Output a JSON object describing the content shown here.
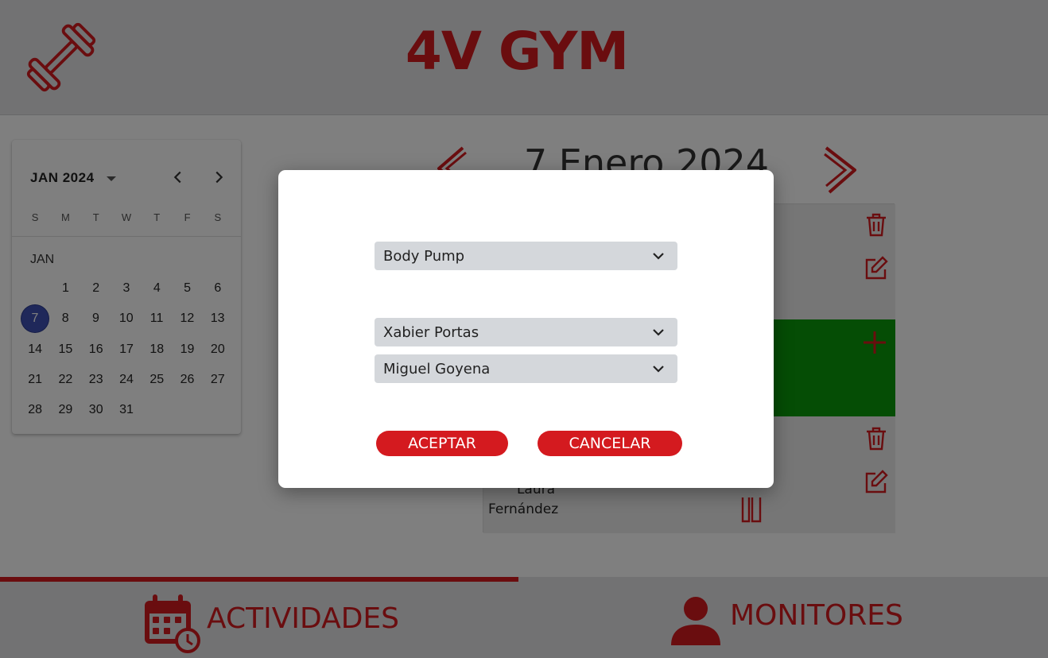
{
  "header": {
    "title": "4V GYM",
    "logo_icon": "dumbbell-icon"
  },
  "calendar": {
    "period_label": "JAN 2024",
    "weekdays": [
      "S",
      "M",
      "T",
      "W",
      "T",
      "F",
      "S"
    ],
    "month_label": "JAN",
    "weeks": [
      [
        "",
        "1",
        "2",
        "3",
        "4",
        "5",
        "6"
      ],
      [
        "7",
        "8",
        "9",
        "10",
        "11",
        "12",
        "13"
      ],
      [
        "14",
        "15",
        "16",
        "17",
        "18",
        "19",
        "20"
      ],
      [
        "21",
        "22",
        "23",
        "24",
        "25",
        "26",
        "27"
      ],
      [
        "28",
        "29",
        "30",
        "31",
        "",
        "",
        ""
      ]
    ],
    "selected_day": "7",
    "accent_color": "#3f51b5"
  },
  "day_view": {
    "date_title": "7 Enero 2024",
    "slots": [
      {
        "state": "filled",
        "color": "#ececec",
        "icons": [
          "trash-icon",
          "edit-icon"
        ]
      },
      {
        "state": "empty",
        "color": "#0a9a0a",
        "icons": [
          "plus-icon"
        ]
      },
      {
        "state": "filled",
        "color": "#ececec",
        "icons": [
          "trash-icon",
          "edit-icon"
        ],
        "monitor_first": "Laura",
        "monitor_last": "Fernández"
      }
    ]
  },
  "modal": {
    "activity_value": "Body Pump",
    "monitor1_value": "Xabier Portas",
    "monitor2_value": "Miguel Goyena",
    "accept_label": "ACEPTAR",
    "cancel_label": "CANCELAR"
  },
  "footer": {
    "tabs": [
      {
        "label": "ACTIVIDADES",
        "icon": "calendar-clock-icon",
        "active": true
      },
      {
        "label": "MONITORES",
        "icon": "user-icon",
        "active": false
      }
    ]
  },
  "colors": {
    "brand_red": "#d41a1f",
    "slot_green": "#0a9a0a"
  }
}
